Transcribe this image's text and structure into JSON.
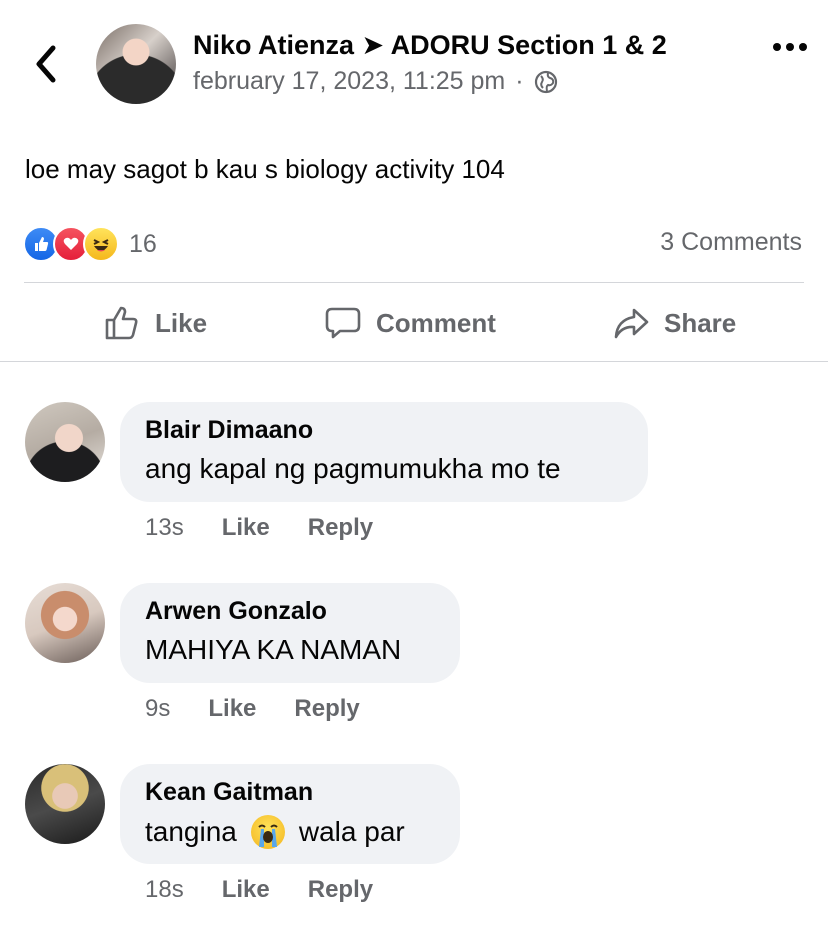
{
  "post": {
    "author": "Niko Atienza",
    "arrow": "➤",
    "group": "ADORU Section 1 & 2",
    "timestamp": "february 17, 2023, 11:25 pm",
    "dot": "·",
    "privacy_icon": "globe-icon",
    "text": "loe may sagot b kau s biology activity 104",
    "reaction_icons": [
      "like-reaction-icon",
      "love-reaction-icon",
      "haha-reaction-icon"
    ],
    "reaction_count": "16",
    "comments_label": "3 Comments"
  },
  "actions": {
    "like": "Like",
    "comment": "Comment",
    "share": "Share"
  },
  "comments": [
    {
      "name": "Blair Dimaano",
      "text": "ang kapal ng pagmumukha mo te",
      "time": "13s",
      "like": "Like",
      "reply": "Reply"
    },
    {
      "name": "Arwen Gonzalo",
      "text": "MAHIYA KA NAMAN",
      "time": "9s",
      "like": "Like",
      "reply": "Reply"
    },
    {
      "name": "Kean Gaitman",
      "text_before": "tangina",
      "emoji": "loudly-crying-face-emoji",
      "text_after": "wala par",
      "time": "18s",
      "like": "Like",
      "reply": "Reply"
    }
  ],
  "colors": {
    "primary_text": "#050505",
    "secondary_text": "#65676b",
    "bubble_bg": "#f0f2f5",
    "divider": "#d4d6da",
    "like_blue": "#1877f2",
    "love_red": "#f02849",
    "haha_yellow": "#f7b928"
  }
}
